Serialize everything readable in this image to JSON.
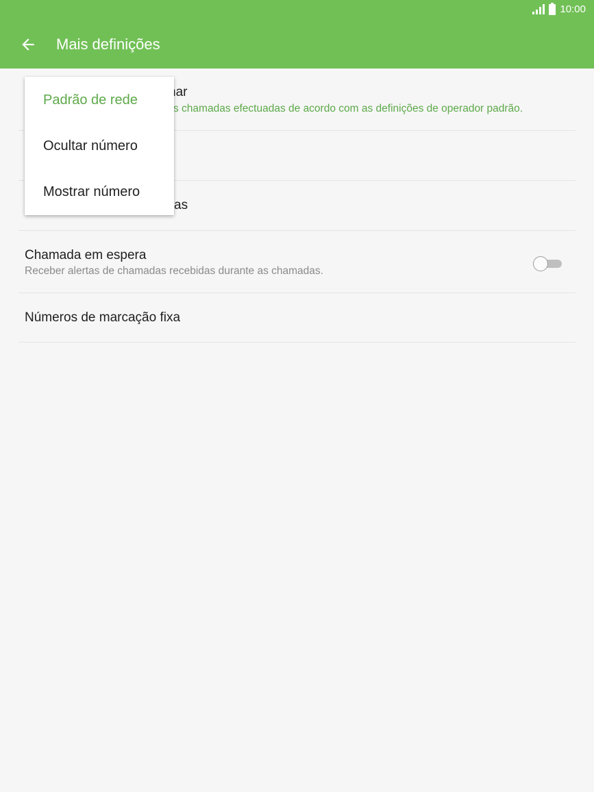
{
  "status_bar": {
    "time": "10:00",
    "icons": [
      "signal-icon",
      "battery-icon"
    ]
  },
  "app_bar": {
    "title": "Mais definições",
    "back_icon": "back-arrow-icon"
  },
  "settings": [
    {
      "title_visible": "nar",
      "subtitle_visible": "s chamadas efectuadas de acordo com as definições de operador padrão."
    },
    {
      "title_visible": ""
    },
    {
      "title_visible": "as"
    },
    {
      "title": "Chamada em espera",
      "subtitle": "Receber alertas de chamadas recebidas durante as chamadas.",
      "toggle_on": false
    },
    {
      "title": "Números de marcação fixa"
    }
  ],
  "dropdown": {
    "selected": "Padrão de rede",
    "options": [
      "Padrão de rede",
      "Ocultar número",
      "Mostrar número"
    ]
  },
  "colors": {
    "accent": "#71c056",
    "accent_text": "#5da94a",
    "background": "#f6f6f6"
  }
}
